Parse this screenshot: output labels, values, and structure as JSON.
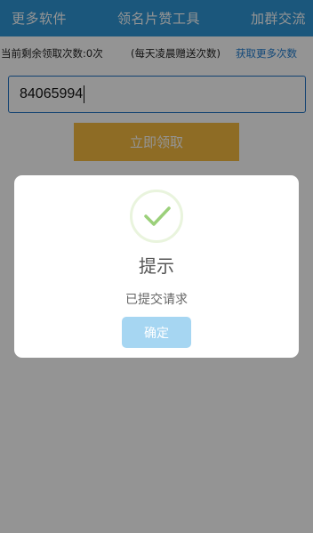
{
  "header": {
    "left_link": "更多软件",
    "title": "领名片赞工具",
    "right_link": "加群交流"
  },
  "info": {
    "remaining": "当前剩余领取次数:0次",
    "daily_note": "(每天凌晨赠送次数)",
    "get_more": "获取更多次数"
  },
  "form": {
    "id_value": "84065994",
    "claim_label": "立即领取"
  },
  "dialog": {
    "title": "提示",
    "message": "已提交请求",
    "confirm_label": "确定",
    "icon": "checkmark-icon"
  },
  "colors": {
    "header_bg": "#2f97d6",
    "claim_button": "#f4ba40",
    "link": "#1f7dd0",
    "confirm_button": "#a6d6f2",
    "check": "#9bd07a"
  }
}
